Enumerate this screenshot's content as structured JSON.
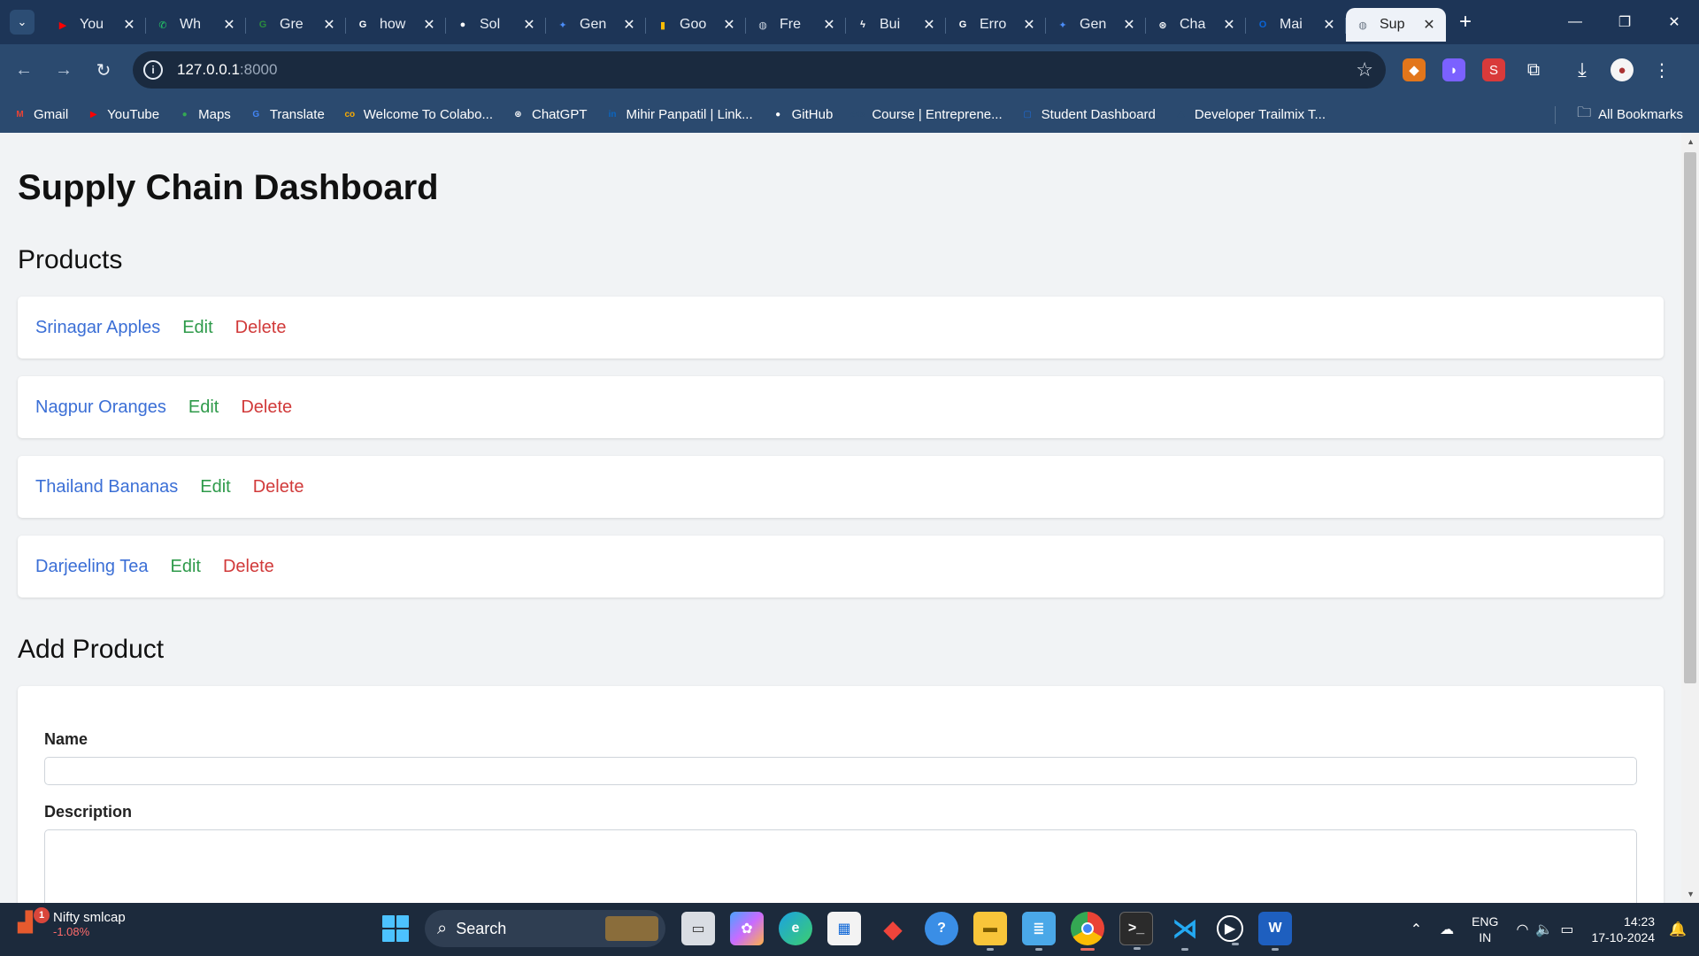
{
  "browser": {
    "tabs": [
      {
        "title": "You",
        "favicon": "youtube-icon",
        "color": "#ff0000",
        "glyph": "▶"
      },
      {
        "title": "Wh",
        "favicon": "whatsapp-icon",
        "color": "#25d366",
        "glyph": "✆"
      },
      {
        "title": "Gre",
        "favicon": "grepper-icon",
        "color": "#2b8a3e",
        "glyph": "G"
      },
      {
        "title": "how",
        "favicon": "google-icon",
        "color": "#ffffff",
        "glyph": "G"
      },
      {
        "title": "Sol",
        "favicon": "github-icon",
        "color": "#ffffff",
        "glyph": "●"
      },
      {
        "title": "Gen",
        "favicon": "gemini-icon",
        "color": "#4b8df8",
        "glyph": "✦"
      },
      {
        "title": "Goo",
        "favicon": "google-maps-icon",
        "color": "#fbbc04",
        "glyph": "▮"
      },
      {
        "title": "Fre",
        "favicon": "globe-icon",
        "color": "#c7d0dc",
        "glyph": "◍"
      },
      {
        "title": "Bui",
        "favicon": "bolt-icon",
        "color": "#ffffff",
        "glyph": "ϟ"
      },
      {
        "title": "Erro",
        "favicon": "google-icon",
        "color": "#ffffff",
        "glyph": "G"
      },
      {
        "title": "Gen",
        "favicon": "gemini-icon",
        "color": "#4b8df8",
        "glyph": "✦"
      },
      {
        "title": "Cha",
        "favicon": "chatgpt-icon",
        "color": "#ffffff",
        "glyph": "⊛"
      },
      {
        "title": "Mai",
        "favicon": "outlook-icon",
        "color": "#0a64d6",
        "glyph": "O"
      },
      {
        "title": "Sup",
        "favicon": "globe-icon",
        "color": "#6b7785",
        "glyph": "◍",
        "active": true
      }
    ],
    "url_host": "127.0.0.1",
    "url_port": ":8000",
    "bookmarks": [
      {
        "label": "Gmail",
        "icon": "gmail-icon",
        "color": "#ea4335",
        "glyph": "M"
      },
      {
        "label": "YouTube",
        "icon": "youtube-icon",
        "color": "#ff0000",
        "glyph": "▶"
      },
      {
        "label": "Maps",
        "icon": "maps-pin-icon",
        "color": "#34a853",
        "glyph": "●"
      },
      {
        "label": "Translate",
        "icon": "translate-icon",
        "color": "#4285f4",
        "glyph": "G"
      },
      {
        "label": "Welcome To Colabo...",
        "icon": "colab-icon",
        "color": "#f9ab00",
        "glyph": "co"
      },
      {
        "label": "ChatGPT",
        "icon": "chatgpt-icon",
        "color": "#ffffff",
        "glyph": "⊛"
      },
      {
        "label": "Mihir Panpatil | Link...",
        "icon": "linkedin-icon",
        "color": "#0a66c2",
        "glyph": "in"
      },
      {
        "label": "GitHub",
        "icon": "github-icon",
        "color": "#ffffff",
        "glyph": "●"
      },
      {
        "label": "Course | Entreprene...",
        "icon": "edx-icon",
        "color": "#2b4a6f",
        "glyph": "edx"
      },
      {
        "label": "Student Dashboard",
        "icon": "dashboard-icon",
        "color": "#1e6bd6",
        "glyph": "▢"
      },
      {
        "label": "Developer Trailmix T...",
        "icon": "trailhead-icon",
        "color": "#2b4a6f",
        "glyph": "⛰"
      }
    ],
    "all_bookmarks": "All Bookmarks"
  },
  "page": {
    "title": "Supply Chain Dashboard",
    "products_heading": "Products",
    "products": [
      {
        "name": "Srinagar Apples",
        "edit": "Edit",
        "delete": "Delete"
      },
      {
        "name": "Nagpur Oranges",
        "edit": "Edit",
        "delete": "Delete"
      },
      {
        "name": "Thailand Bananas",
        "edit": "Edit",
        "delete": "Delete"
      },
      {
        "name": "Darjeeling Tea",
        "edit": "Edit",
        "delete": "Delete"
      }
    ],
    "add_heading": "Add Product",
    "form": {
      "name_label": "Name",
      "description_label": "Description"
    }
  },
  "taskbar": {
    "widget_title": "Nifty smlcap",
    "widget_value": "-1.08%",
    "widget_badge": "1",
    "search_label": "Search",
    "lang_line1": "ENG",
    "lang_line2": "IN",
    "time": "14:23",
    "date": "17-10-2024"
  }
}
